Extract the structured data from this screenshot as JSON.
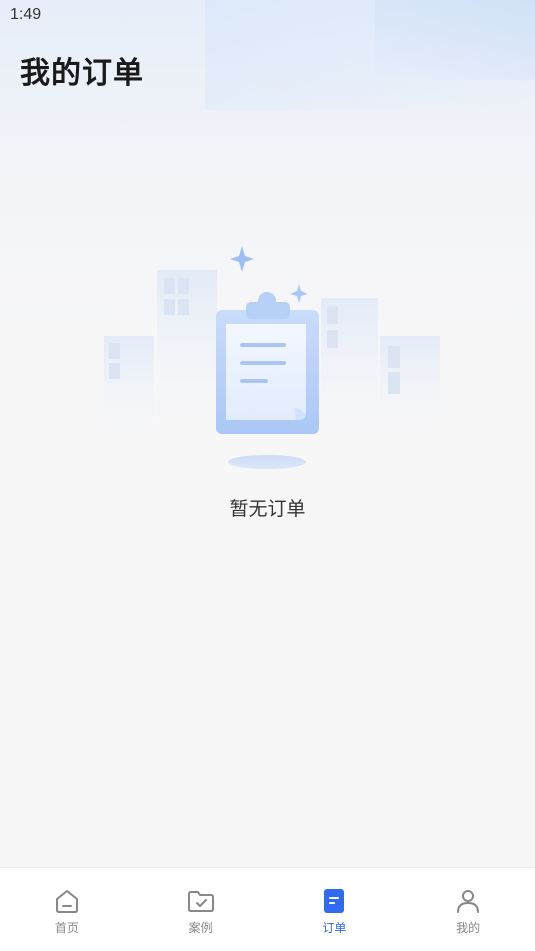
{
  "status_bar": {
    "time": "1:49"
  },
  "header": {
    "title": "我的订单"
  },
  "empty_state": {
    "message": "暂无订单"
  },
  "tabbar": {
    "active_color": "#2f6bf0",
    "inactive_color": "#888888",
    "items": [
      {
        "label": "首页",
        "icon": "home-icon",
        "active": false
      },
      {
        "label": "案例",
        "icon": "folder-check-icon",
        "active": false
      },
      {
        "label": "订单",
        "icon": "order-document-icon",
        "active": true
      },
      {
        "label": "我的",
        "icon": "user-icon",
        "active": false
      }
    ]
  }
}
